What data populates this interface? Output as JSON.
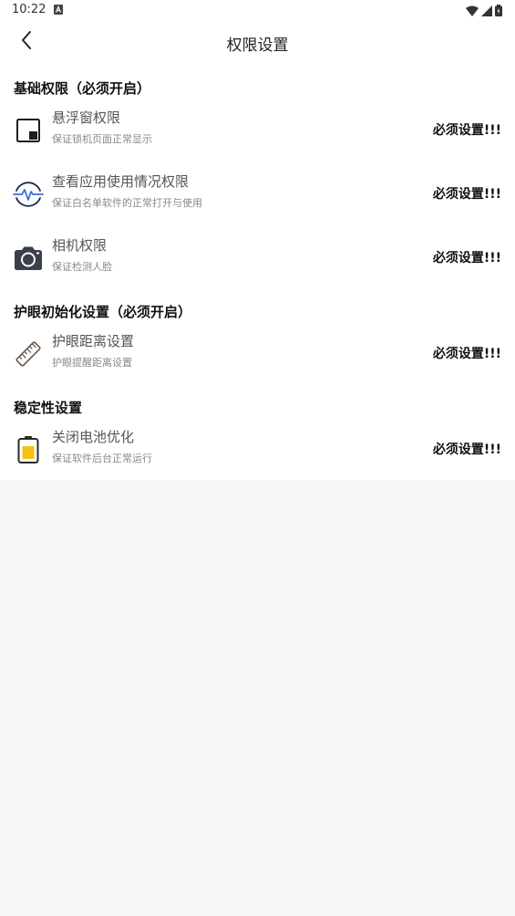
{
  "status_bar": {
    "time": "10:22",
    "notification_icon": "a-box-icon",
    "icons": [
      "wifi-icon",
      "signal-icon",
      "battery-icon"
    ]
  },
  "app_bar": {
    "back_icon": "chevron-left-icon",
    "title": "权限设置"
  },
  "sections": [
    {
      "title": "基础权限（必须开启）",
      "items": [
        {
          "icon": "floating-window-icon",
          "title": "悬浮窗权限",
          "subtitle": "保证锁机页面正常显示",
          "status": "必须设置!!!"
        },
        {
          "icon": "usage-pulse-icon",
          "title": "查看应用使用情况权限",
          "subtitle": "保证白名单软件的正常打开与使用",
          "status": "必须设置!!!"
        },
        {
          "icon": "camera-icon",
          "title": "相机权限",
          "subtitle": "保证检测人脸",
          "status": "必须设置!!!"
        }
      ]
    },
    {
      "title": "护眼初始化设置（必须开启）",
      "items": [
        {
          "icon": "ruler-icon",
          "title": "护眼距离设置",
          "subtitle": "护眼提醒距离设置",
          "status": "必须设置!!!"
        }
      ]
    },
    {
      "title": "稳定性设置",
      "items": [
        {
          "icon": "battery-icon",
          "title": "关闭电池优化",
          "subtitle": "保证软件后台正常运行",
          "status": "必须设置!!!"
        }
      ]
    }
  ],
  "colors": {
    "page_background": "#f6f5f8",
    "card_background": "#ffffff",
    "accent_blue": "#3d6fd6",
    "battery_fill": "#f5c016"
  }
}
